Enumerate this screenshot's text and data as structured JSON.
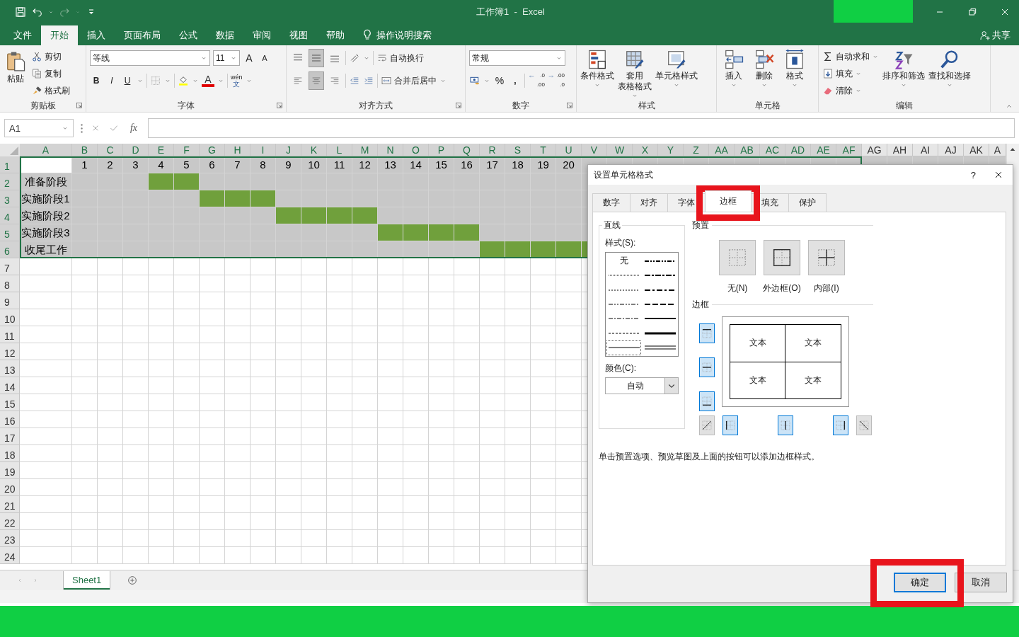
{
  "title_bar": {
    "title": "工作簿1  -  Excel"
  },
  "menu_tabs": [
    {
      "label": "文件",
      "selected": false
    },
    {
      "label": "开始",
      "selected": true
    },
    {
      "label": "插入",
      "selected": false
    },
    {
      "label": "页面布局",
      "selected": false
    },
    {
      "label": "公式",
      "selected": false
    },
    {
      "label": "数据",
      "selected": false
    },
    {
      "label": "审阅",
      "selected": false
    },
    {
      "label": "视图",
      "selected": false
    },
    {
      "label": "帮助",
      "selected": false
    }
  ],
  "search": "操作说明搜索",
  "share": "共享",
  "ribbon": {
    "clipboard": {
      "label": "剪贴板",
      "paste": "粘贴",
      "items": [
        {
          "kind": "cut",
          "label": "剪切"
        },
        {
          "kind": "copy",
          "label": "复制"
        },
        {
          "kind": "painter",
          "label": "格式刷"
        }
      ]
    },
    "font": {
      "label": "字体",
      "name": "等线",
      "size": "11",
      "grow": "A",
      "shrink": "A",
      "bold": "B",
      "italic": "I",
      "underline": "U",
      "color_letter": "A",
      "phonetic_top": "wén",
      "phonetic_bottom": "文"
    },
    "alignment": {
      "label": "对齐方式",
      "wrap": "自动换行",
      "merge": "合并后居中",
      "align_buttons": [
        {
          "kind": "top",
          "selected": false
        },
        {
          "kind": "middle",
          "selected": true
        },
        {
          "kind": "bottom",
          "selected": false
        },
        {
          "kind": "left",
          "selected": false
        },
        {
          "kind": "center",
          "selected": true
        },
        {
          "kind": "right",
          "selected": false
        }
      ]
    },
    "number": {
      "label": "数字",
      "format": "常规",
      "percent": "%",
      "comma": ",",
      "decimals": [
        {
          "top": ".0",
          "bottom": ".00"
        },
        {
          "top": ".00",
          "bottom": ".0"
        }
      ]
    },
    "styles": {
      "label": "样式",
      "items": [
        {
          "kind": "conditional",
          "lines": [
            "条件格式"
          ]
        },
        {
          "kind": "table",
          "lines": [
            "套用",
            "表格格式"
          ]
        },
        {
          "kind": "cellstyle",
          "lines": [
            "单元格样式"
          ]
        }
      ]
    },
    "cells": {
      "label": "单元格",
      "items": [
        {
          "kind": "insert",
          "lines": [
            "插入"
          ]
        },
        {
          "kind": "delete",
          "lines": [
            "删除"
          ]
        },
        {
          "kind": "format",
          "lines": [
            "格式"
          ]
        }
      ]
    },
    "editing": {
      "label": "编辑",
      "small": [
        {
          "kind": "sum",
          "label": "自动求和"
        },
        {
          "kind": "filldown",
          "label": "填充"
        },
        {
          "kind": "clear",
          "label": "清除"
        }
      ],
      "large": [
        {
          "kind": "sort",
          "label": "排序和筛选"
        },
        {
          "kind": "find",
          "label": "查找和选择"
        }
      ]
    }
  },
  "formula_bar": {
    "name_box": "A1",
    "fx": "fx"
  },
  "sheet": {
    "columns": [
      {
        "label": "A",
        "selected": true
      },
      {
        "label": "B",
        "selected": true
      },
      {
        "label": "C",
        "selected": true
      },
      {
        "label": "D",
        "selected": true
      },
      {
        "label": "E",
        "selected": true
      },
      {
        "label": "F",
        "selected": true
      },
      {
        "label": "G",
        "selected": true
      },
      {
        "label": "H",
        "selected": true
      },
      {
        "label": "I",
        "selected": true
      },
      {
        "label": "J",
        "selected": true
      },
      {
        "label": "K",
        "selected": true
      },
      {
        "label": "L",
        "selected": true
      },
      {
        "label": "M",
        "selected": true
      },
      {
        "label": "N",
        "selected": true
      },
      {
        "label": "O",
        "selected": true
      },
      {
        "label": "P",
        "selected": true
      },
      {
        "label": "Q",
        "selected": true
      },
      {
        "label": "R",
        "selected": true
      },
      {
        "label": "S",
        "selected": true
      },
      {
        "label": "T",
        "selected": true
      },
      {
        "label": "U",
        "selected": true
      },
      {
        "label": "V",
        "selected": true
      },
      {
        "label": "W",
        "selected": true
      },
      {
        "label": "X",
        "selected": true
      },
      {
        "label": "Y",
        "selected": true
      },
      {
        "label": "Z",
        "selected": true
      },
      {
        "label": "AA",
        "selected": true
      },
      {
        "label": "AB",
        "selected": true
      },
      {
        "label": "AC",
        "selected": true
      },
      {
        "label": "AD",
        "selected": true
      },
      {
        "label": "AE",
        "selected": true
      },
      {
        "label": "AF",
        "selected": true
      },
      {
        "label": "AG",
        "selected": false
      },
      {
        "label": "AH",
        "selected": false
      },
      {
        "label": "AI",
        "selected": false
      },
      {
        "label": "AJ",
        "selected": false
      },
      {
        "label": "AK",
        "selected": false
      },
      {
        "label": "A",
        "selected": false
      }
    ],
    "rows": [
      {
        "label": "1",
        "selected": true
      },
      {
        "label": "2",
        "selected": true
      },
      {
        "label": "3",
        "selected": true
      },
      {
        "label": "4",
        "selected": true
      },
      {
        "label": "5",
        "selected": true
      },
      {
        "label": "6",
        "selected": true
      },
      {
        "label": "7",
        "selected": false
      },
      {
        "label": "8",
        "selected": false
      },
      {
        "label": "9",
        "selected": false
      },
      {
        "label": "10",
        "selected": false
      },
      {
        "label": "11",
        "selected": false
      },
      {
        "label": "12",
        "selected": false
      },
      {
        "label": "13",
        "selected": false
      },
      {
        "label": "14",
        "selected": false
      },
      {
        "label": "15",
        "selected": false
      },
      {
        "label": "16",
        "selected": false
      },
      {
        "label": "17",
        "selected": false
      },
      {
        "label": "18",
        "selected": false
      },
      {
        "label": "19",
        "selected": false
      },
      {
        "label": "20",
        "selected": false
      },
      {
        "label": "21",
        "selected": false
      },
      {
        "label": "22",
        "selected": false
      },
      {
        "label": "23",
        "selected": false
      },
      {
        "label": "24",
        "selected": false
      }
    ],
    "day_numbers": [
      "1",
      "2",
      "3",
      "4",
      "5",
      "6",
      "7",
      "8",
      "9",
      "10",
      "11",
      "12",
      "13",
      "14",
      "15",
      "16",
      "17",
      "18",
      "19",
      "20"
    ],
    "phases": [
      {
        "label": "准备阶段",
        "fills": [
          false,
          false,
          false,
          true,
          true,
          false,
          false,
          false,
          false,
          false,
          false,
          false,
          false,
          false,
          false,
          false,
          false,
          false,
          false,
          false,
          false
        ]
      },
      {
        "label": "实施阶段1",
        "fills": [
          false,
          false,
          false,
          false,
          false,
          true,
          true,
          true,
          false,
          false,
          false,
          false,
          false,
          false,
          false,
          false,
          false,
          false,
          false,
          false,
          false
        ]
      },
      {
        "label": "实施阶段2",
        "fills": [
          false,
          false,
          false,
          false,
          false,
          false,
          false,
          false,
          true,
          true,
          true,
          true,
          false,
          false,
          false,
          false,
          false,
          false,
          false,
          false,
          false
        ]
      },
      {
        "label": "实施阶段3",
        "fills": [
          false,
          false,
          false,
          false,
          false,
          false,
          false,
          false,
          false,
          false,
          false,
          false,
          true,
          true,
          true,
          true,
          false,
          false,
          false,
          false,
          false
        ]
      },
      {
        "label": "收尾工作",
        "fills": [
          false,
          false,
          false,
          false,
          false,
          false,
          false,
          false,
          false,
          false,
          false,
          false,
          false,
          false,
          false,
          false,
          true,
          true,
          true,
          true,
          true
        ]
      }
    ]
  },
  "sheet_tabs": [
    {
      "label": "Sheet1",
      "selected": true
    }
  ],
  "dialog": {
    "title": "设置单元格格式",
    "help": "?",
    "tabs": [
      {
        "label": "数字",
        "selected": false
      },
      {
        "label": "对齐",
        "selected": false
      },
      {
        "label": "字体",
        "selected": false
      },
      {
        "label": "边框",
        "selected": true
      },
      {
        "label": "填充",
        "selected": false
      },
      {
        "label": "保护",
        "selected": false
      }
    ],
    "line_group": "直线",
    "style_label": "样式(S):",
    "line_styles": [
      {
        "kind": "none",
        "label": "无",
        "selected": false
      },
      {
        "kind": "hair",
        "selected": false
      },
      {
        "kind": "dotted",
        "selected": false
      },
      {
        "kind": "dashdotdot",
        "selected": false
      },
      {
        "kind": "dashdot",
        "selected": false
      },
      {
        "kind": "dashed",
        "selected": false
      },
      {
        "kind": "thin",
        "selected": true
      },
      {
        "kind": "mdashdotdot",
        "selected": false
      },
      {
        "kind": "slant",
        "selected": false
      },
      {
        "kind": "mdashdot",
        "selected": false
      },
      {
        "kind": "mdashed",
        "selected": false
      },
      {
        "kind": "medium",
        "selected": false
      },
      {
        "kind": "thick",
        "selected": false
      },
      {
        "kind": "double",
        "selected": false
      }
    ],
    "color_label": "颜色(C):",
    "color_value": "自动",
    "preset_label": "预置",
    "presets": [
      {
        "kind": "none",
        "label": "无(N)"
      },
      {
        "kind": "outline",
        "label": "外边框(O)"
      },
      {
        "kind": "inside",
        "label": "内部(I)"
      }
    ],
    "border_label": "边框",
    "preview_texts": [
      "文本",
      "文本",
      "文本",
      "文本"
    ],
    "border_buttons": [
      {
        "kind": "top",
        "on": true
      },
      {
        "kind": "middle_h",
        "on": true
      },
      {
        "kind": "bottom",
        "on": true
      },
      {
        "kind": "diag_up",
        "on": false
      },
      {
        "kind": "left",
        "on": true
      },
      {
        "kind": "middle_v",
        "on": true
      },
      {
        "kind": "right",
        "on": true
      },
      {
        "kind": "diag_down",
        "on": false
      }
    ],
    "hint": "单击预置选项、预览草图及上面的按钮可以添加边框样式。",
    "buttons": [
      {
        "label": "确定",
        "default": true
      },
      {
        "label": "取消",
        "default": false
      }
    ]
  }
}
